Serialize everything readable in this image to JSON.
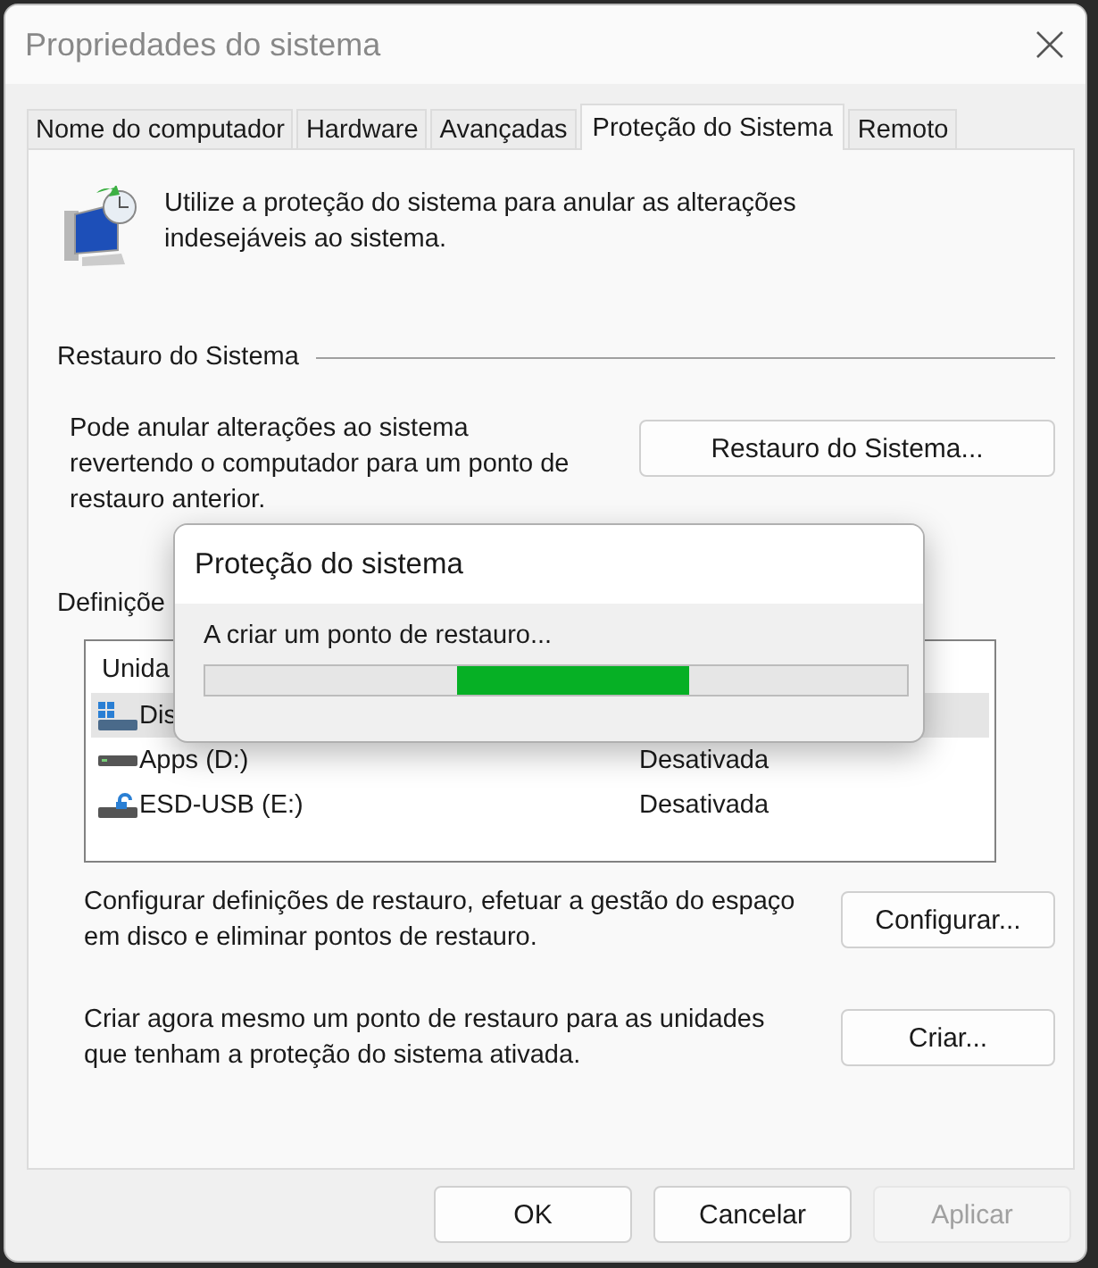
{
  "window": {
    "title": "Propriedades do sistema"
  },
  "tabs": [
    {
      "label": "Nome do computador",
      "selected": false
    },
    {
      "label": "Hardware",
      "selected": false
    },
    {
      "label": "Avançadas",
      "selected": false
    },
    {
      "label": "Proteção do Sistema",
      "selected": true
    },
    {
      "label": "Remoto",
      "selected": false
    }
  ],
  "intro": "Utilize a proteção do sistema para anular as alterações indesejáveis ao sistema.",
  "restore_section": {
    "heading": "Restauro do Sistema",
    "description": "Pode anular alterações ao sistema revertendo o computador para um ponto de restauro anterior.",
    "button": "Restauro do Sistema..."
  },
  "settings_section": {
    "heading": "Definiçõe",
    "table": {
      "columns": [
        "Unida"
      ],
      "rows": [
        {
          "name": "Dis",
          "kind": "system",
          "selected": true
        },
        {
          "name": "Apps (D:)",
          "kind": "drive",
          "status": "Desativada",
          "selected": false
        },
        {
          "name": "ESD-USB (E:)",
          "kind": "usb",
          "status": "Desativada",
          "selected": false
        }
      ]
    }
  },
  "actions": [
    {
      "text": "Configurar definições de restauro, efetuar a gestão do espaço em disco e eliminar pontos de restauro.",
      "button": "Configurar..."
    },
    {
      "text": "Criar agora mesmo um ponto de restauro para as unidades que tenham a proteção do sistema ativada.",
      "button": "Criar..."
    }
  ],
  "footer_buttons": [
    {
      "label": "OK",
      "disabled": false
    },
    {
      "label": "Cancelar",
      "disabled": false
    },
    {
      "label": "Aplicar",
      "disabled": true
    }
  ],
  "progress_dialog": {
    "title": "Proteção do sistema",
    "message": "A criar um ponto de restauro...",
    "indeterminate": true
  }
}
